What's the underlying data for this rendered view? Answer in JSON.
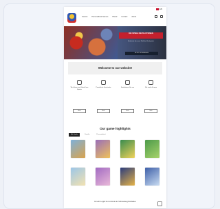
{
  "header": {
    "language": "EN",
    "nav_items": [
      "Games",
      "Personalized Games",
      "Brand",
      "Contact",
      "About"
    ]
  },
  "hero": {
    "title": "DIE SPIELE REVOLUTIONEN",
    "subtitle": "Entdecke die neue Welt der Brettspiele",
    "cta": "JETZT MITSPIELEN",
    "accent_color": "#c4202d"
  },
  "welcome": {
    "heading": "Welcome to our website!"
  },
  "features": [
    {
      "icon": "box-icon",
      "text": "Wir liefern eine Vielzahl von Spielen",
      "button": "Mehr"
    },
    {
      "icon": "gift-icon",
      "text": "Persönliche Geschenke",
      "button": "Mehr"
    },
    {
      "icon": "chat-icon",
      "text": "Kontaktieren Sie uns",
      "button": "Mehr"
    },
    {
      "icon": "pin-icon",
      "text": "Wir sind in Europa",
      "button": "Mehr"
    }
  ],
  "games": {
    "heading": "Our game highlights",
    "tabs": [
      "Alle Spiele",
      "Familie",
      "Personalisiert"
    ],
    "items": [
      {
        "color_a": "#7fb0d8",
        "color_b": "#d9a34d"
      },
      {
        "color_a": "#9a6fb8",
        "color_b": "#efc15b"
      },
      {
        "color_a": "#3a8c4e",
        "color_b": "#f0d25a"
      },
      {
        "color_a": "#4d9a4a",
        "color_b": "#a7d36a"
      },
      {
        "color_a": "#9cc6e8",
        "color_b": "#f3e2b0"
      },
      {
        "color_a": "#a26bc2",
        "color_b": "#e9b8d8"
      },
      {
        "color_a": "#2c3d7c",
        "color_b": "#e6b347"
      },
      {
        "color_a": "#3e5fa8",
        "color_b": "#c9dcf2"
      }
    ]
  },
  "footer": {
    "text": "Immerhin ergibt bis zum Ende der Schüsselweg Rostbalken"
  }
}
